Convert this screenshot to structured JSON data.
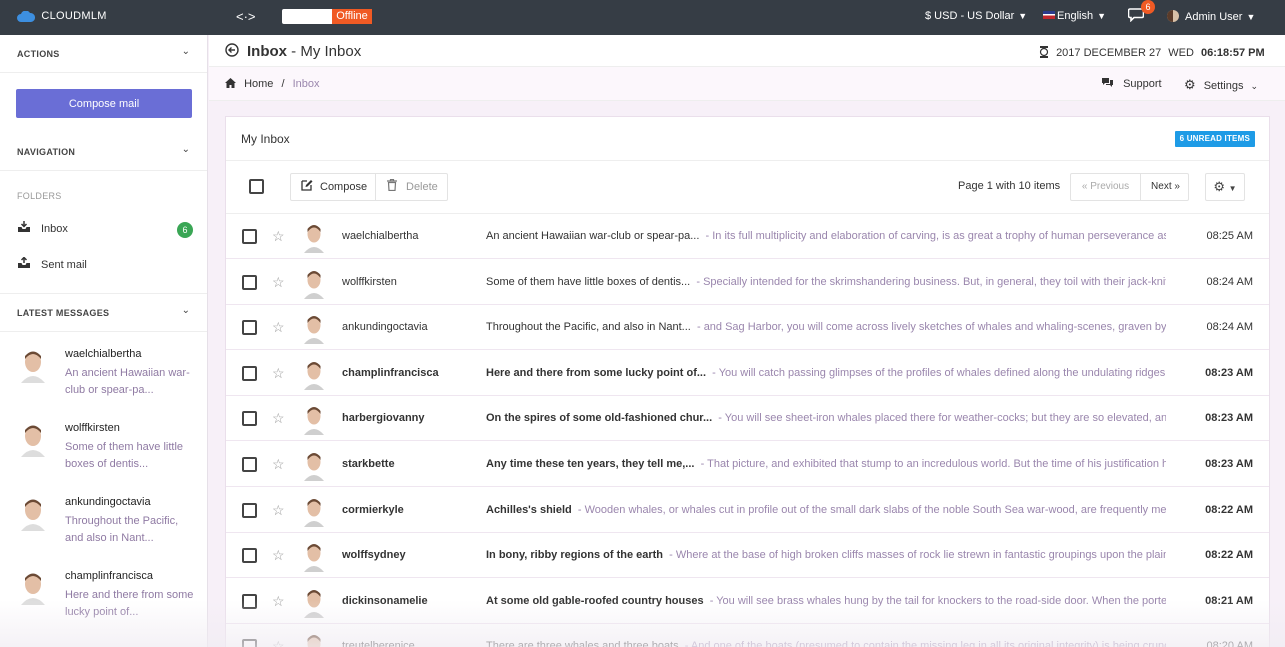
{
  "topbar": {
    "brand": "CLOUDMLM",
    "offline_label": "Offline",
    "currency": "$ USD - US Dollar",
    "language": "English",
    "chat_badge": "6",
    "user": "Admin User"
  },
  "sidebar": {
    "actions_title": "ACTIONS",
    "compose_label": "Compose mail",
    "navigation_title": "NAVIGATION",
    "folders_title": "FOLDERS",
    "folders": [
      {
        "label": "Inbox",
        "badge": "6"
      },
      {
        "label": "Sent mail"
      }
    ],
    "latest_title": "LATEST MESSAGES",
    "latest": [
      {
        "name": "waelchialbertha",
        "preview": "An ancient Hawaiian war-club or spear-pa..."
      },
      {
        "name": "wolffkirsten",
        "preview": "Some of them have little boxes of dentis..."
      },
      {
        "name": "ankundingoctavia",
        "preview": "Throughout the Pacific, and also in Nant..."
      },
      {
        "name": "champlinfrancisca",
        "preview": "Here and there from some lucky point of..."
      }
    ]
  },
  "header": {
    "title_bold": "Inbox",
    "title_rest": "- My Inbox",
    "date": "2017 DECEMBER 27",
    "weekday": "WED",
    "time": "06:18:57 PM"
  },
  "breadcrumb": {
    "home": "Home",
    "separator": "/",
    "current": "Inbox",
    "support": "Support",
    "settings": "Settings"
  },
  "panel": {
    "title": "My Inbox",
    "unread_badge": "6 UNREAD ITEMS",
    "compose": "Compose",
    "delete": "Delete",
    "page_info": "Page 1 with 10 items",
    "previous": "« Previous",
    "next": "Next »"
  },
  "messages": [
    {
      "from": "waelchialbertha",
      "subject": "An ancient Hawaiian war-club or spear-pa...",
      "snippet": "- In its full multiplicity and elaboration of carving, is as great a trophy of human perseverance as a La...",
      "time": "08:25 AM",
      "unread": false
    },
    {
      "from": "wolffkirsten",
      "subject": "Some of them have little boxes of dentis...",
      "snippet": "- Specially intended for the skrimshandering business. But, in general, they toil with their jack-knives al...",
      "time": "08:24 AM",
      "unread": false
    },
    {
      "from": "ankundingoctavia",
      "subject": "Throughout the Pacific, and also in Nant...",
      "snippet": "- and Sag Harbor, you will come across lively sketches of whales and whaling-scenes, graven by the fis...",
      "time": "08:24 AM",
      "unread": false
    },
    {
      "from": "champlinfrancisca",
      "subject": "Here and there from some lucky point of...",
      "snippet": "- You will catch passing glimpses of the profiles of whales defined along the undulating ridges. But y...",
      "time": "08:23 AM",
      "unread": true
    },
    {
      "from": "harbergiovanny",
      "subject": "On the spires of some old-fashioned chur...",
      "snippet": "- You will see sheet-iron whales placed there for weather-cocks; but they are so elevated, and besid...",
      "time": "08:23 AM",
      "unread": true
    },
    {
      "from": "starkbette",
      "subject": "Any time these ten years, they tell me,...",
      "snippet": "- That picture, and exhibited that stump to an incredulous world. But the time of his justification has no...",
      "time": "08:23 AM",
      "unread": true
    },
    {
      "from": "cormierkyle",
      "subject": "Achilles's shield",
      "snippet": "- Wooden whales, or whales cut in profile out of the small dark slabs of the noble South Sea war-wood, are frequently met with i...",
      "time": "08:22 AM",
      "unread": true
    },
    {
      "from": "wolffsydney",
      "subject": "In bony, ribby regions of the earth",
      "snippet": "- Where at the base of high broken cliffs masses of rock lie strewn in fantastic groupings upon the plain, you ...",
      "time": "08:22 AM",
      "unread": true
    },
    {
      "from": "dickinsonamelie",
      "subject": "At some old gable-roofed country houses",
      "snippet": "- You will see brass whales hung by the tail for knockers to the road-side door. When the porter is slee...",
      "time": "08:21 AM",
      "unread": true
    },
    {
      "from": "treutelberenice",
      "subject": "There are three whales and three boats",
      "snippet": "- And one of the boats (presumed to contain the missing leg in all its original integrity) is being crunched...",
      "time": "08:20 AM",
      "unread": false
    }
  ]
}
